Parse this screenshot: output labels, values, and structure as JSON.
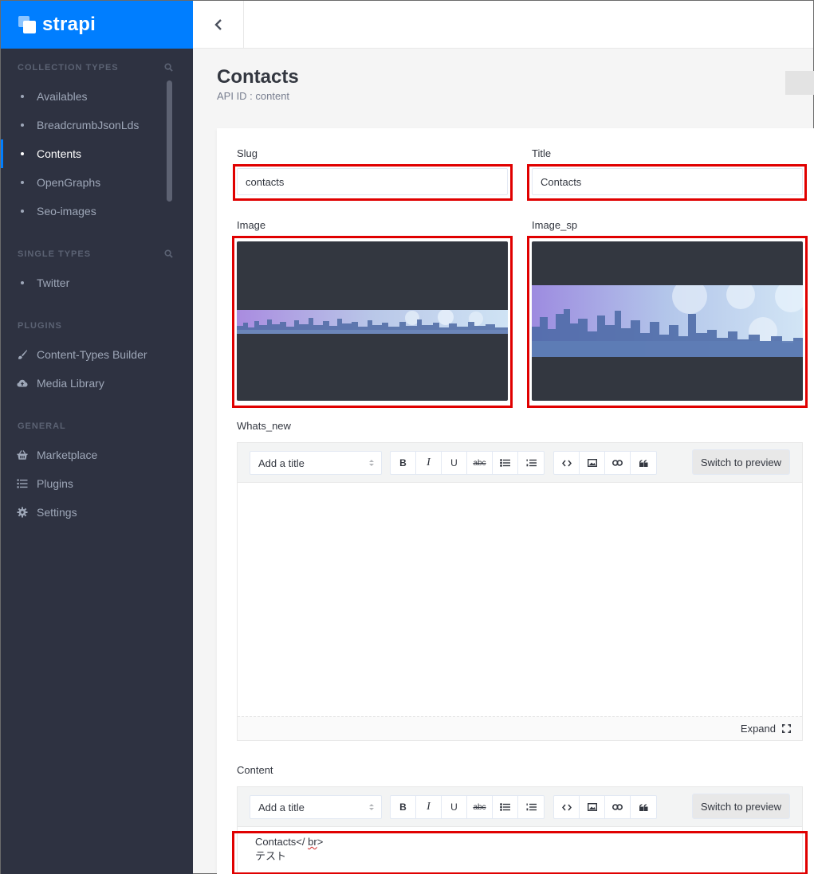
{
  "brand": {
    "name": "strapi",
    "accent": "#007eff"
  },
  "sidebar": {
    "collection_types": {
      "title": "COLLECTION TYPES",
      "items": [
        {
          "label": "Availables"
        },
        {
          "label": "BreadcrumbJsonLds"
        },
        {
          "label": "Contents",
          "active": true
        },
        {
          "label": "OpenGraphs"
        },
        {
          "label": "Seo-images"
        }
      ]
    },
    "single_types": {
      "title": "SINGLE TYPES",
      "items": [
        {
          "label": "Twitter"
        }
      ]
    },
    "plugins": {
      "title": "PLUGINS",
      "items": [
        {
          "label": "Content-Types Builder",
          "icon": "paintbrush-icon"
        },
        {
          "label": "Media Library",
          "icon": "cloud-upload-icon"
        }
      ]
    },
    "general": {
      "title": "GENERAL",
      "items": [
        {
          "label": "Marketplace",
          "icon": "basket-icon"
        },
        {
          "label": "Plugins",
          "icon": "list-icon"
        },
        {
          "label": "Settings",
          "icon": "gear-icon"
        }
      ]
    }
  },
  "header": {
    "back_icon": "chevron-left-icon"
  },
  "page": {
    "title": "Contacts",
    "subtitle": "API ID : content"
  },
  "form": {
    "slug": {
      "label": "Slug",
      "value": "contacts"
    },
    "title": {
      "label": "Title",
      "value": "Contacts"
    },
    "image": {
      "label": "Image"
    },
    "image_sp": {
      "label": "Image_sp"
    },
    "whats_new": {
      "label": "Whats_new",
      "select_placeholder": "Add a title",
      "preview_button": "Switch to preview",
      "expand_label": "Expand"
    },
    "content": {
      "label": "Content",
      "select_placeholder": "Add a title",
      "preview_button": "Switch to preview",
      "text_prefix": "Contacts</ ",
      "text_tag": "br",
      "text_suffix": ">",
      "text_line2": "テスト"
    }
  },
  "toolbar": {
    "bold": "B",
    "italic": "I",
    "underline": "U",
    "strike": "abc"
  },
  "colors": {
    "highlight_frame": "#e00000",
    "sidebar_bg": "#2e3241"
  }
}
